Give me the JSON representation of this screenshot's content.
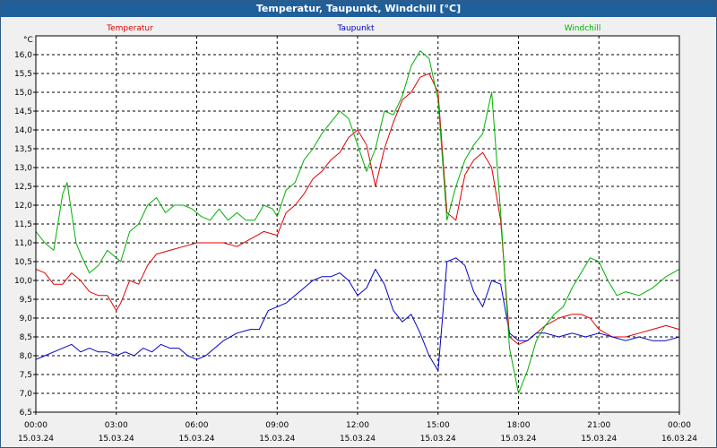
{
  "title": "Temperatur, Taupunkt, Windchill [°C]",
  "colors": {
    "background": "#f0f0f0",
    "titlebar": "#1f5f9a"
  },
  "chart_data": {
    "type": "line",
    "title": "Temperatur, Taupunkt, Windchill [°C]",
    "ylabel": "°C",
    "xlabel": "",
    "ylim": [
      6.5,
      16.5
    ],
    "xlim": [
      "2024-03-15 00:00",
      "2024-03-16 00:00"
    ],
    "grid": true,
    "legend": "top",
    "y_ticks": [
      "6,5",
      "7,0",
      "7,5",
      "8,0",
      "8,5",
      "9,0",
      "9,5",
      "10,0",
      "10,5",
      "11,0",
      "11,5",
      "12,0",
      "12,5",
      "13,0",
      "13,5",
      "14,0",
      "14,5",
      "15,0",
      "15,5",
      "16,0"
    ],
    "x_ticks": [
      {
        "time": "00:00",
        "date": "15.03.24"
      },
      {
        "time": "03:00",
        "date": "15.03.24"
      },
      {
        "time": "06:00",
        "date": "15.03.24"
      },
      {
        "time": "09:00",
        "date": "15.03.24"
      },
      {
        "time": "12:00",
        "date": "15.03.24"
      },
      {
        "time": "15:00",
        "date": "15.03.24"
      },
      {
        "time": "18:00",
        "date": "15.03.24"
      },
      {
        "time": "21:00",
        "date": "15.03.24"
      },
      {
        "time": "00:00",
        "date": "16.03.24"
      }
    ],
    "series": [
      {
        "name": "Temperatur",
        "color": "#e00000",
        "x": [
          "00:00",
          "00:20",
          "00:40",
          "01:00",
          "01:20",
          "01:40",
          "02:00",
          "02:20",
          "02:40",
          "03:00",
          "03:10",
          "03:30",
          "03:50",
          "04:10",
          "04:30",
          "05:00",
          "05:30",
          "06:00",
          "06:30",
          "07:00",
          "07:30",
          "08:00",
          "08:30",
          "09:00",
          "09:20",
          "09:40",
          "10:00",
          "10:20",
          "10:40",
          "11:00",
          "11:20",
          "11:40",
          "12:00",
          "12:20",
          "12:40",
          "13:00",
          "13:20",
          "13:40",
          "14:00",
          "14:20",
          "14:40",
          "15:00",
          "15:20",
          "15:40",
          "16:00",
          "16:20",
          "16:40",
          "17:00",
          "17:20",
          "17:40",
          "18:00",
          "18:20",
          "18:40",
          "19:00",
          "19:30",
          "20:00",
          "20:20",
          "20:40",
          "21:00",
          "21:30",
          "22:00",
          "22:30",
          "23:00",
          "23:30",
          "00:00"
        ],
        "values": [
          10.3,
          10.2,
          9.9,
          9.9,
          10.2,
          10.0,
          9.7,
          9.6,
          9.6,
          9.2,
          9.4,
          10.0,
          9.9,
          10.4,
          10.7,
          10.8,
          10.9,
          11.0,
          11.0,
          11.0,
          10.9,
          11.1,
          11.3,
          11.2,
          11.8,
          12.0,
          12.3,
          12.7,
          12.9,
          13.2,
          13.4,
          13.8,
          14.0,
          13.6,
          12.5,
          13.5,
          14.2,
          14.8,
          15.0,
          15.4,
          15.5,
          15.0,
          11.8,
          11.6,
          12.8,
          13.2,
          13.4,
          13.0,
          11.6,
          8.5,
          8.3,
          8.4,
          8.6,
          8.8,
          9.0,
          9.1,
          9.1,
          9.0,
          8.7,
          8.5,
          8.5,
          8.6,
          8.7,
          8.8,
          8.7
        ]
      },
      {
        "name": "Taupunkt",
        "color": "#0000c8",
        "x": [
          "00:00",
          "00:20",
          "00:40",
          "01:00",
          "01:20",
          "01:40",
          "02:00",
          "02:20",
          "02:40",
          "03:00",
          "03:20",
          "03:40",
          "04:00",
          "04:20",
          "04:40",
          "05:00",
          "05:20",
          "05:40",
          "06:00",
          "06:20",
          "06:40",
          "07:00",
          "07:30",
          "08:00",
          "08:20",
          "08:40",
          "09:00",
          "09:20",
          "09:40",
          "10:00",
          "10:20",
          "10:40",
          "11:00",
          "11:20",
          "11:40",
          "12:00",
          "12:20",
          "12:40",
          "13:00",
          "13:20",
          "13:40",
          "14:00",
          "14:20",
          "14:40",
          "15:00",
          "15:10",
          "15:20",
          "15:40",
          "16:00",
          "16:20",
          "16:40",
          "17:00",
          "17:20",
          "17:40",
          "18:00",
          "18:20",
          "18:40",
          "19:00",
          "19:30",
          "20:00",
          "20:30",
          "21:00",
          "21:30",
          "22:00",
          "22:30",
          "23:00",
          "23:30",
          "00:00"
        ],
        "values": [
          7.9,
          8.0,
          8.1,
          8.2,
          8.3,
          8.1,
          8.2,
          8.1,
          8.1,
          8.0,
          8.1,
          8.0,
          8.2,
          8.1,
          8.3,
          8.2,
          8.2,
          8.0,
          7.9,
          8.0,
          8.2,
          8.4,
          8.6,
          8.7,
          8.7,
          9.2,
          9.3,
          9.4,
          9.6,
          9.8,
          10.0,
          10.1,
          10.1,
          10.2,
          10.0,
          9.6,
          9.8,
          10.3,
          9.9,
          9.2,
          8.9,
          9.1,
          8.6,
          8.0,
          7.6,
          9.0,
          10.5,
          10.6,
          10.4,
          9.7,
          9.3,
          10.0,
          9.9,
          8.6,
          8.4,
          8.4,
          8.6,
          8.6,
          8.5,
          8.6,
          8.5,
          8.6,
          8.5,
          8.4,
          8.5,
          8.4,
          8.4,
          8.5
        ]
      },
      {
        "name": "Windchill",
        "color": "#00b000",
        "x": [
          "00:00",
          "00:20",
          "00:40",
          "01:00",
          "01:10",
          "01:30",
          "01:40",
          "02:00",
          "02:10",
          "02:20",
          "02:40",
          "03:00",
          "03:10",
          "03:30",
          "03:50",
          "04:10",
          "04:30",
          "04:50",
          "05:10",
          "05:30",
          "05:50",
          "06:10",
          "06:30",
          "06:50",
          "07:10",
          "07:30",
          "07:50",
          "08:10",
          "08:30",
          "08:50",
          "09:00",
          "09:20",
          "09:40",
          "10:00",
          "10:20",
          "10:40",
          "11:00",
          "11:20",
          "11:40",
          "12:00",
          "12:20",
          "12:40",
          "13:00",
          "13:20",
          "13:40",
          "14:00",
          "14:20",
          "14:40",
          "15:00",
          "15:20",
          "15:40",
          "16:00",
          "16:20",
          "16:40",
          "17:00",
          "17:20",
          "17:40",
          "18:00",
          "18:20",
          "18:40",
          "19:00",
          "19:20",
          "19:40",
          "20:00",
          "20:20",
          "20:40",
          "21:00",
          "21:20",
          "21:40",
          "22:00",
          "22:30",
          "23:00",
          "23:30",
          "00:00"
        ],
        "values": [
          11.3,
          11.0,
          10.8,
          12.3,
          12.6,
          11.0,
          10.7,
          10.2,
          10.3,
          10.4,
          10.8,
          10.6,
          10.5,
          11.3,
          11.5,
          12.0,
          12.2,
          11.8,
          12.0,
          12.0,
          11.9,
          11.7,
          11.6,
          11.9,
          11.6,
          11.8,
          11.6,
          11.6,
          12.0,
          11.9,
          11.7,
          12.4,
          12.6,
          13.2,
          13.5,
          13.9,
          14.2,
          14.5,
          14.3,
          13.6,
          12.9,
          13.5,
          14.5,
          14.4,
          14.9,
          15.7,
          16.1,
          15.9,
          14.8,
          11.6,
          12.5,
          13.2,
          13.6,
          13.9,
          15.0,
          11.8,
          8.2,
          7.0,
          7.6,
          8.4,
          8.8,
          9.1,
          9.3,
          9.8,
          10.2,
          10.6,
          10.5,
          10.0,
          9.6,
          9.7,
          9.6,
          9.8,
          10.1,
          10.3
        ]
      }
    ]
  }
}
